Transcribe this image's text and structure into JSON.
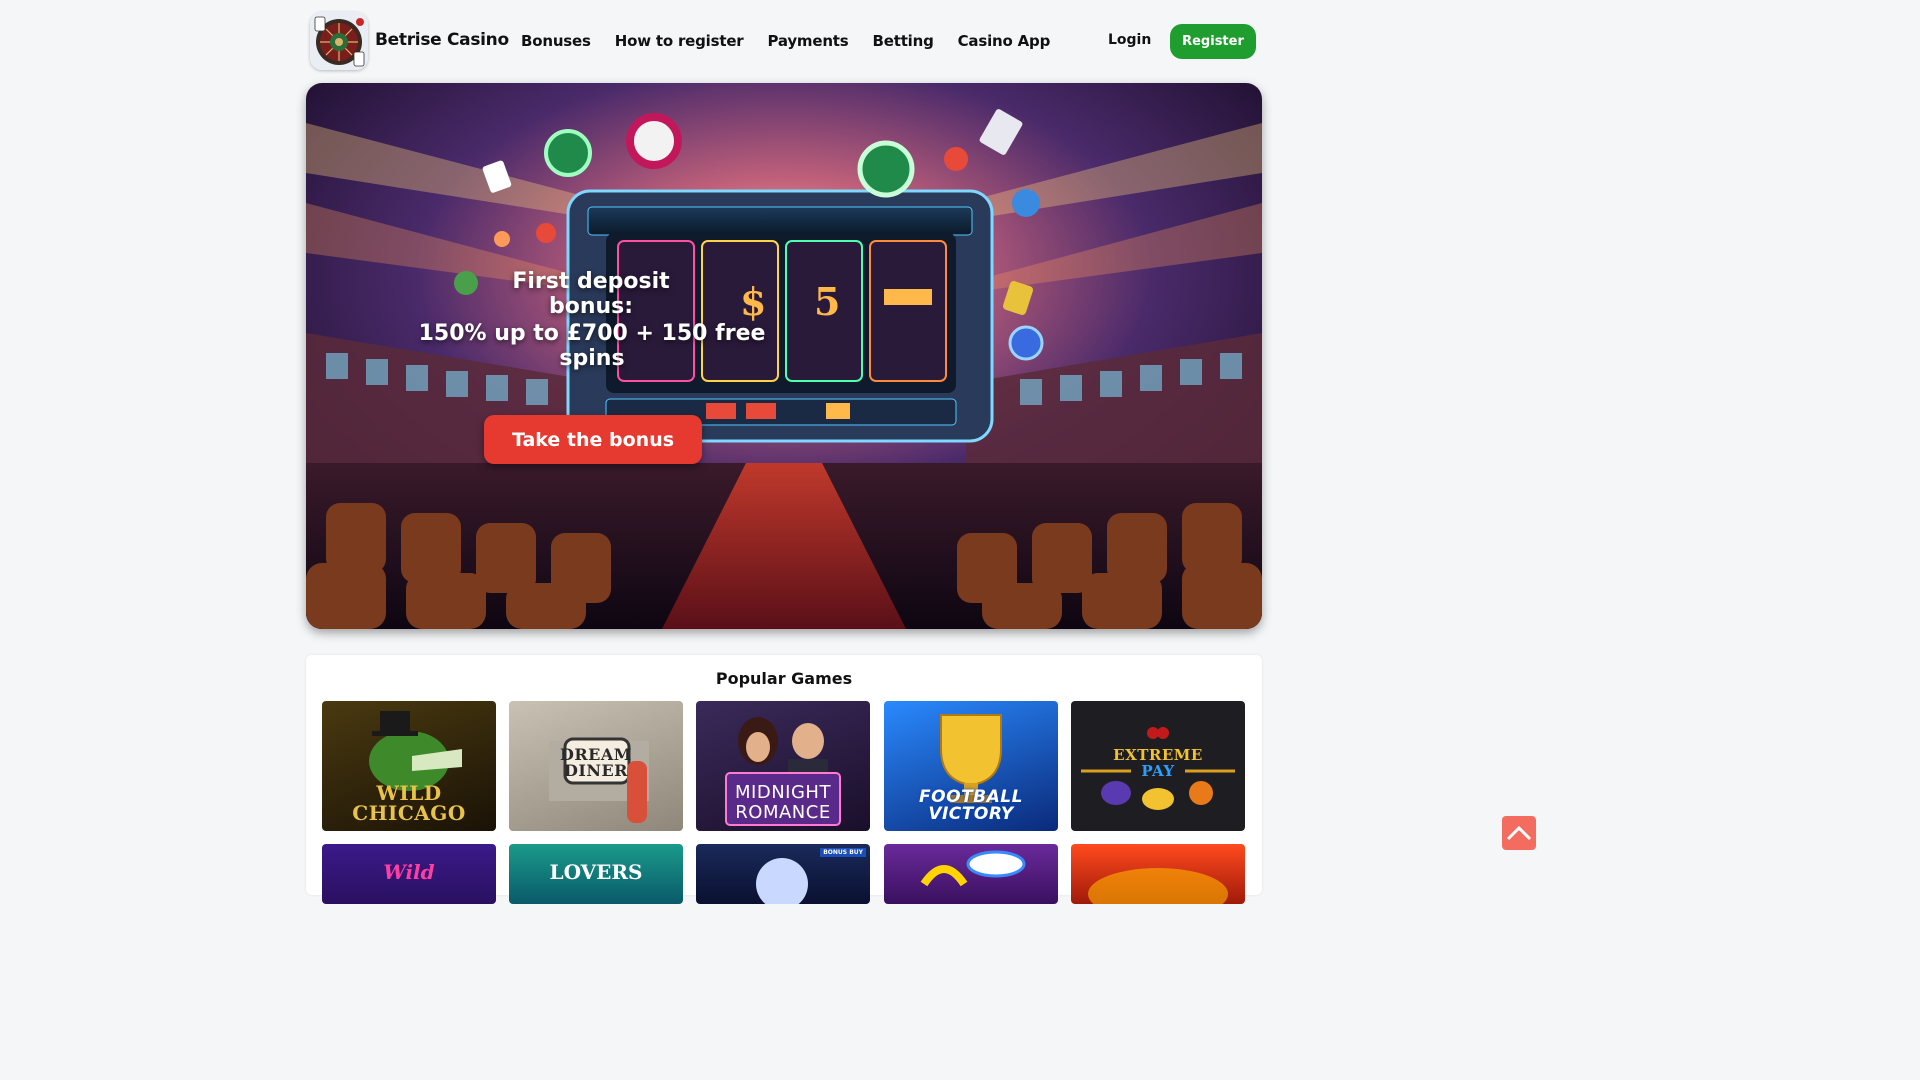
{
  "header": {
    "brand": "Betrise Casino",
    "nav": [
      "Bonuses",
      "How to register",
      "Payments",
      "Betting",
      "Casino App"
    ],
    "login": "Login",
    "register": "Register"
  },
  "hero": {
    "line1": "First deposit bonus:",
    "line2": "150% up to £700 + 150 free spins",
    "cta": "Take the bonus"
  },
  "games": {
    "title": "Popular Games",
    "row1": [
      {
        "name_line1": "WILD",
        "name_line2": "CHICAGO",
        "accent": "#d6a53a"
      },
      {
        "name_line1": "DREAM",
        "name_line2": "DINER",
        "accent": "#2a2a2a"
      },
      {
        "name_line1": "MIDNIGHT",
        "name_line2": "ROMANCE",
        "accent": "#ffffff"
      },
      {
        "name_line1": "FOOTBALL",
        "name_line2": "VICTORY",
        "accent": "#2e7bff"
      },
      {
        "name_line1": "EXTREME",
        "name_line2": "PAY",
        "accent": "#f2c230"
      }
    ],
    "row2": [
      {
        "name": "Wild",
        "accent": "#ff3fa0"
      },
      {
        "name": "LOVERS",
        "accent": "#ffffff"
      },
      {
        "name": "",
        "tag": "BONUS BUY"
      },
      {
        "name": "",
        "accent": "#ffd400"
      },
      {
        "name": "",
        "accent": "#ff3c1e"
      }
    ]
  },
  "colors": {
    "register": "#1f9d2e",
    "cta": "#e6392f",
    "to_top": "#f36c5f"
  }
}
